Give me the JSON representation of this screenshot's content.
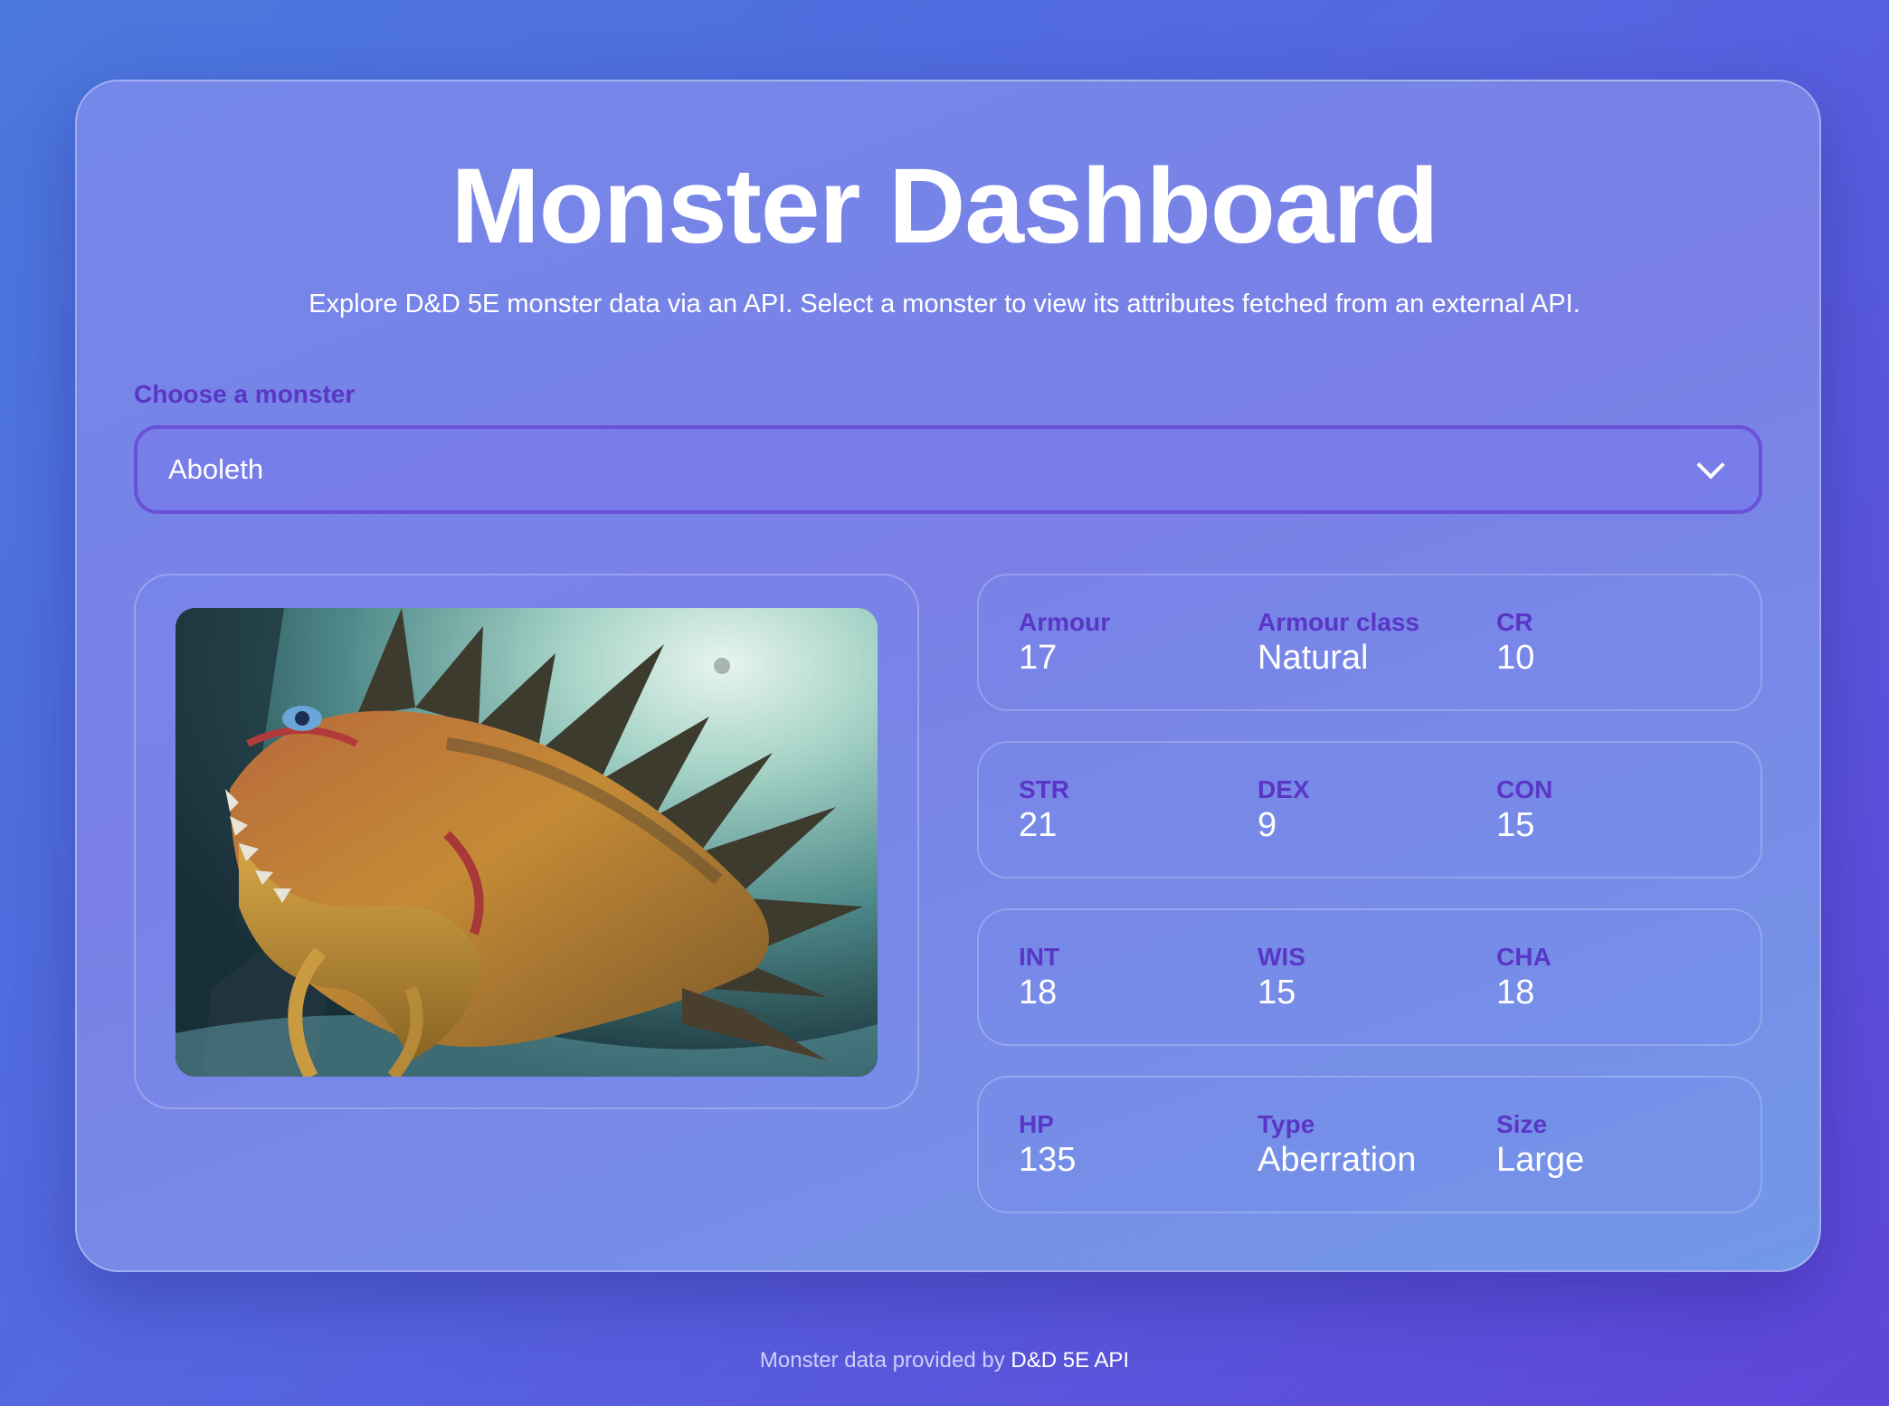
{
  "header": {
    "title": "Monster Dashboard",
    "subtitle": "Explore D&D 5E monster data via an API. Select a monster to view its attributes fetched from an external API."
  },
  "selector": {
    "label": "Choose a monster",
    "selected": "Aboleth"
  },
  "stats": {
    "row1": [
      {
        "label": "Armour",
        "value": "17"
      },
      {
        "label": "Armour class",
        "value": "Natural"
      },
      {
        "label": "CR",
        "value": "10"
      }
    ],
    "row2": [
      {
        "label": "STR",
        "value": "21"
      },
      {
        "label": "DEX",
        "value": "9"
      },
      {
        "label": "CON",
        "value": "15"
      }
    ],
    "row3": [
      {
        "label": "INT",
        "value": "18"
      },
      {
        "label": "WIS",
        "value": "15"
      },
      {
        "label": "CHA",
        "value": "18"
      }
    ],
    "row4": [
      {
        "label": "HP",
        "value": "135"
      },
      {
        "label": "Type",
        "value": "Aberration"
      },
      {
        "label": "Size",
        "value": "Large"
      }
    ]
  },
  "footer": {
    "prefix": "Monster data provided by",
    "link": "D&D 5E API"
  },
  "colors": {
    "accent_label": "#5a36c7",
    "select_border": "#6a52d8"
  }
}
